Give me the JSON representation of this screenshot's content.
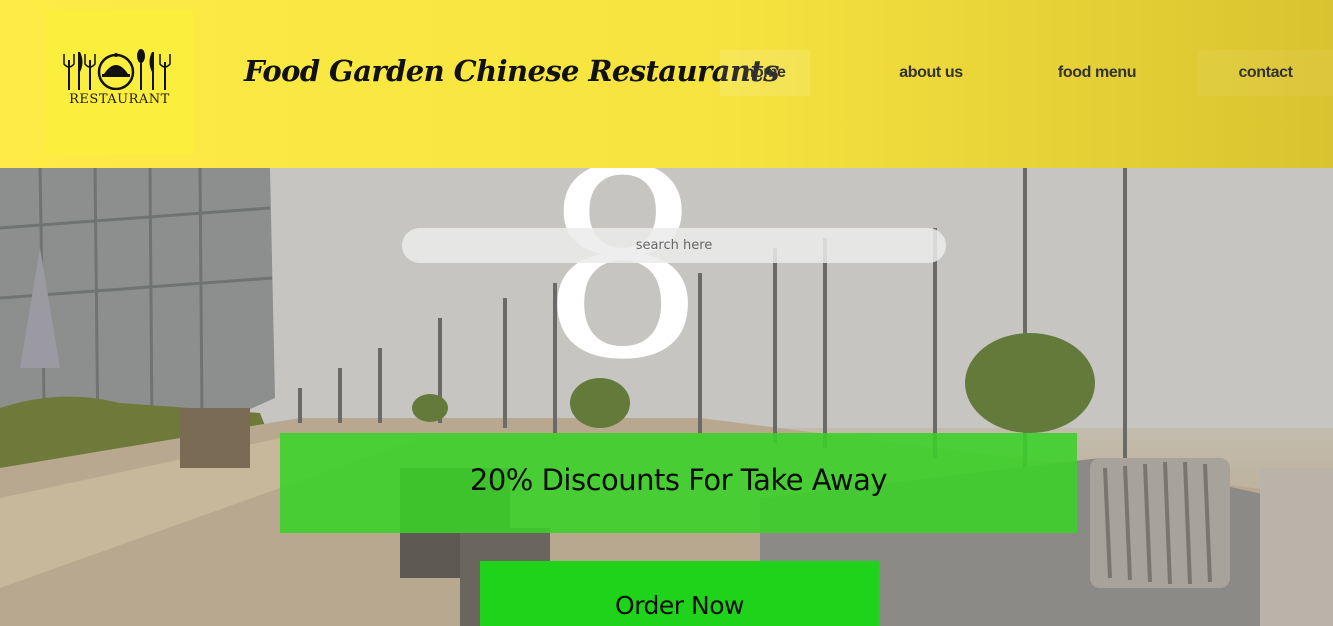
{
  "header": {
    "logo_text": "RESTAURANT",
    "logo_icon": "cutlery-cloche-icon",
    "site_title": "Food Garden Chinese Restaurants"
  },
  "nav": {
    "items": [
      {
        "label": "home",
        "active": true
      },
      {
        "label": "about us"
      },
      {
        "label": "food menu"
      },
      {
        "label": "contact"
      }
    ]
  },
  "hero": {
    "big_glyph": "8",
    "search_placeholder": "search here",
    "discount_text": "20% Discounts For Take Away",
    "order_button_label": "Order Now"
  },
  "colors": {
    "header_yellow": "#fdec45",
    "banner_green": "#3ad228",
    "button_green": "#1ed31a"
  }
}
